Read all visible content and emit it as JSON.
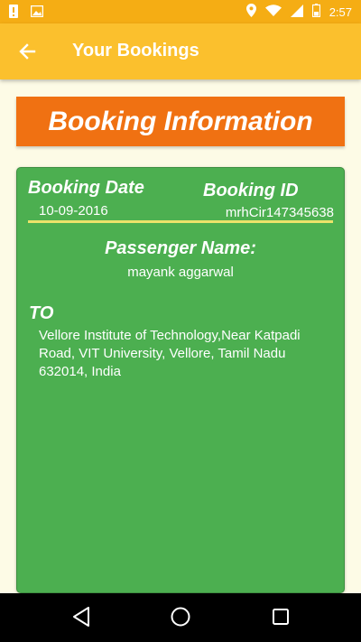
{
  "status_bar": {
    "time": "2:57"
  },
  "app_bar": {
    "title": "Your Bookings"
  },
  "banner": {
    "title": "Booking Information"
  },
  "booking": {
    "date_label": "Booking Date",
    "date_value": "10-09-2016",
    "id_label": "Booking ID",
    "id_value": "mrhCir147345638",
    "passenger_label": "Passenger Name:",
    "passenger_value": "mayank aggarwal",
    "to_label": "TO",
    "to_value": "Vellore Institute of Technology,Near Katpadi Road, VIT University, Vellore, Tamil Nadu 632014, India"
  },
  "colors": {
    "status_bar": "#f5ad14",
    "app_bar": "#fbc02d",
    "banner": "#f07112",
    "card": "#4caf50",
    "divider": "#ebe36a",
    "page_bg": "#fdfbe6"
  },
  "icons": [
    "alert-icon",
    "image-icon",
    "location-icon",
    "wifi-icon",
    "signal-icon",
    "battery-icon",
    "back-arrow-icon",
    "nav-back-icon",
    "nav-home-icon",
    "nav-recents-icon"
  ]
}
